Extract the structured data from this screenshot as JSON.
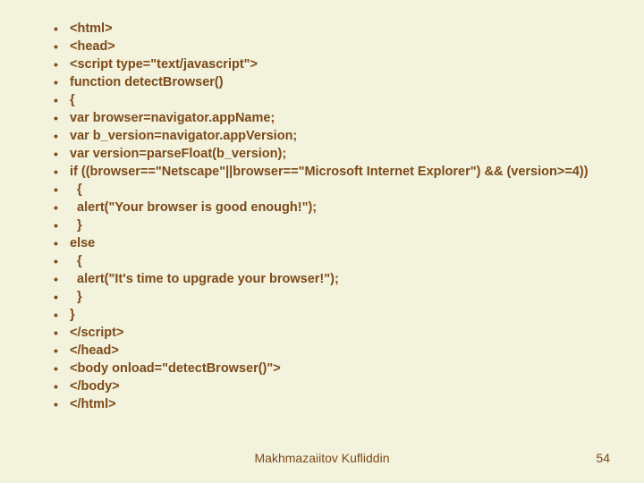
{
  "lines": [
    "<html>",
    "<head>",
    "<script type=\"text/javascript\">",
    "function detectBrowser()",
    "{",
    "var browser=navigator.appName;",
    "var b_version=navigator.appVersion;",
    "var version=parseFloat(b_version);",
    "if ((browser==\"Netscape\"||browser==\"Microsoft Internet Explorer\") && (version>=4))",
    "  {",
    "  alert(\"Your browser is good enough!\");",
    "  }",
    "else",
    "  {",
    "  alert(\"It's time to upgrade your browser!\");",
    "  }",
    "}",
    "</script>",
    "</head>",
    "<body onload=\"detectBrowser()\">",
    "</body>",
    "</html>"
  ],
  "footer": {
    "author": "Makhmazaiitov Kufliddin",
    "page": "54"
  }
}
